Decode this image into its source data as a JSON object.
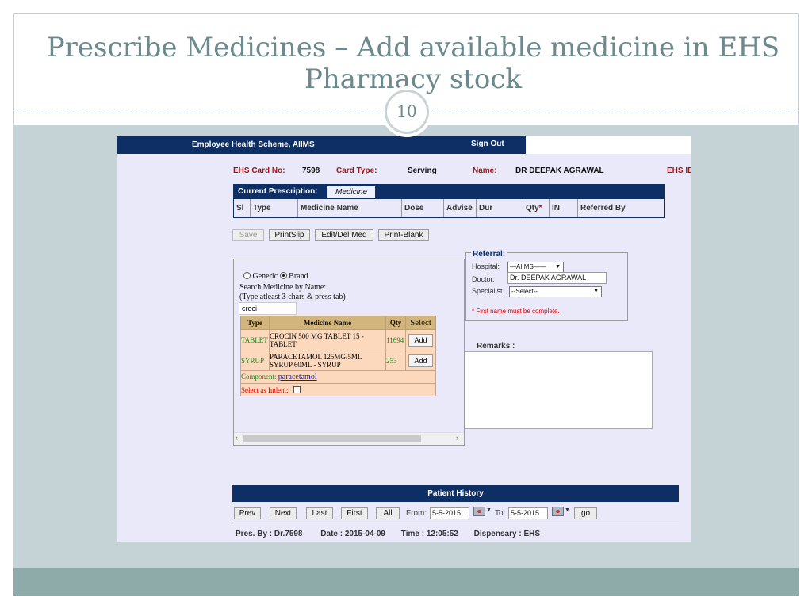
{
  "slide": {
    "title": "Prescribe Medicines – Add available medicine in EHS Pharmacy stock",
    "number": "10"
  },
  "app": {
    "header": {
      "brand": "Employee Health Scheme, AIIMS",
      "sign_out": "Sign Out"
    },
    "patient": {
      "ehs_card_label": "EHS Card No:",
      "ehs_card_value": "7598",
      "card_type_label": "Card Type:",
      "card_type_value": "Serving",
      "name_label": "Name:",
      "name_value": "DR DEEPAK AGRAWAL",
      "ehs_id_label": "EHS ID"
    },
    "prescription": {
      "title": "Current Prescription:",
      "tab": "Medicine",
      "columns": [
        "Sl",
        "Type",
        "Medicine Name",
        "Dose",
        "Advise",
        "Dur",
        "Qty",
        "IN",
        "Referred By"
      ],
      "qty_marker": "*"
    },
    "actions": {
      "save": "Save",
      "print_slip": "PrintSlip",
      "edit_del": "Edit/Del Med",
      "print_blank": "Print-Blank"
    },
    "search": {
      "generic_label": "Generic",
      "brand_label": "Brand",
      "selected": "Brand",
      "instruction_1": "Search  Medicine by Name:",
      "instruction_2a": "(Type atleast ",
      "instruction_2b": "3",
      "instruction_2c": " chars & press tab)",
      "query": "croci",
      "table_headers": [
        "Type",
        "Medicine Name",
        "Qty",
        "Select"
      ],
      "results": [
        {
          "type": "TABLET",
          "name": "CROCIN 500 MG TABLET 15 - TABLET",
          "qty": "11694",
          "action": "Add"
        },
        {
          "type": "SYRUP",
          "name": "PARACETAMOL 125MG/5ML SYRUP 60ML - SYRUP",
          "qty": "253",
          "action": "Add"
        }
      ],
      "component_label": "Component:",
      "component_link": "paracetamol",
      "indent_label": "Select as Indent:"
    },
    "referral": {
      "legend": "Referral:",
      "hospital_label": "Hospital:",
      "hospital_value": "—AIIMS——",
      "doctor_label": "Doctor.",
      "doctor_value": "Dr. DEEPAK AGRAWAL",
      "specialist_label": "Specialist.",
      "specialist_value": "--Select--",
      "note": "* First name must be complete."
    },
    "remarks_label": "Remarks :",
    "history": {
      "title": "Patient History",
      "prev": "Prev",
      "next": "Next",
      "last": "Last",
      "first": "First",
      "all": "All",
      "from_label": "From:",
      "from_value": "5-5-2015",
      "to_label": "To:",
      "to_value": "5-5-2015",
      "go": "go",
      "pres_by": "Pres. By : Dr.7598",
      "date": "Date : 2015-04-09",
      "time": "Time : 12:05:52",
      "dispensary": "Dispensary : EHS"
    }
  },
  "colors": {
    "title": "#6b8a8e",
    "navy": "#0e2f66",
    "label_red": "#a31515",
    "table_header": "#d2b57c",
    "table_body": "#fcd9bd",
    "panel_bg": "#e9e9fa"
  }
}
